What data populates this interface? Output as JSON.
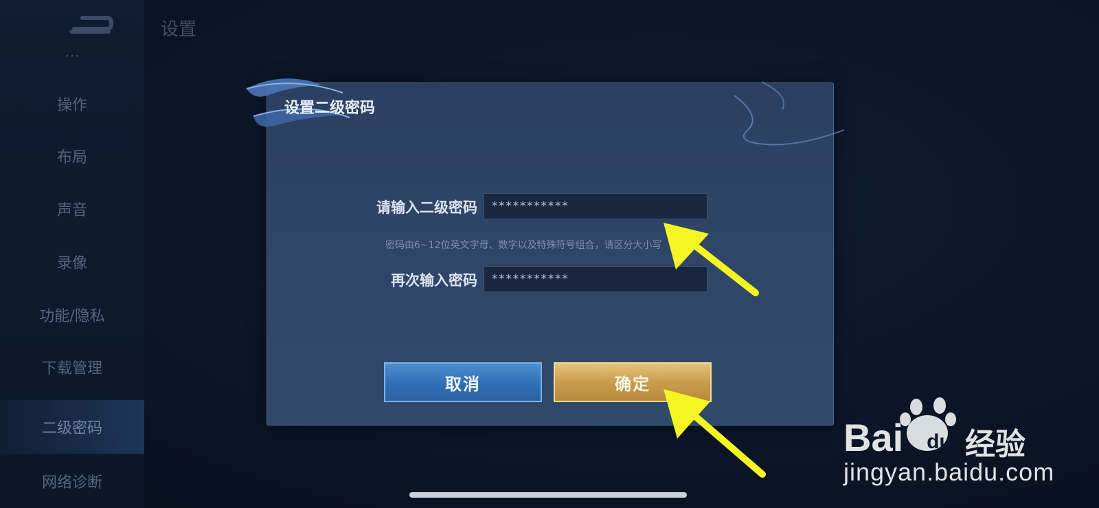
{
  "header": {
    "title": "设置"
  },
  "sidebar": {
    "items": [
      {
        "label": "···",
        "state": "partial"
      },
      {
        "label": "操作"
      },
      {
        "label": "布局"
      },
      {
        "label": "声音"
      },
      {
        "label": "录像"
      },
      {
        "label": "功能/隐私"
      },
      {
        "label": "下载管理"
      },
      {
        "label": "二级密码",
        "state": "active"
      },
      {
        "label": "网络诊断"
      }
    ]
  },
  "dialog": {
    "title": "设置二级密码",
    "password_label": "请输入二级密码",
    "password_value": "***********",
    "hint": "密码由6~12位英文字母、数字以及特殊符号组合，请区分大小写",
    "confirm_label": "再次输入密码",
    "confirm_value": "***********",
    "cancel_button": "取消",
    "ok_button": "确定"
  },
  "watermark": {
    "logo_text": "Bai",
    "logo_du": "du",
    "product": "经验",
    "url": "jingyan.baidu.com"
  },
  "colors": {
    "cancel_button": "#3a7cc2",
    "ok_button": "#d4aa5c",
    "annotation_arrow": "#f5f523",
    "dialog_bg": "#2e4466"
  }
}
